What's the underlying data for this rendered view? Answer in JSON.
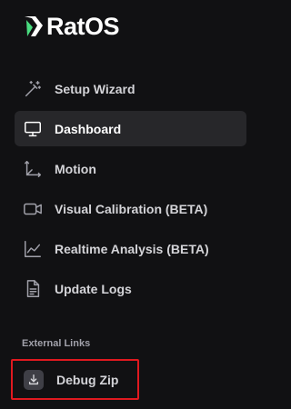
{
  "brand": {
    "name": "RatOS",
    "accent": "#4ade80"
  },
  "nav": {
    "items": [
      {
        "label": "Setup Wizard",
        "icon": "magic-wand-icon",
        "active": false
      },
      {
        "label": "Dashboard",
        "icon": "monitor-icon",
        "active": true
      },
      {
        "label": "Motion",
        "icon": "axes-icon",
        "active": false
      },
      {
        "label": "Visual Calibration (BETA)",
        "icon": "video-camera-icon",
        "active": false
      },
      {
        "label": "Realtime Analysis (BETA)",
        "icon": "line-chart-icon",
        "active": false
      },
      {
        "label": "Update Logs",
        "icon": "document-icon",
        "active": false
      }
    ]
  },
  "external_links": {
    "heading": "External Links",
    "items": [
      {
        "label": "Debug Zip",
        "icon": "download-icon",
        "highlight_color": "#e0191f"
      }
    ]
  },
  "colors": {
    "background": "#111113",
    "active_background": "#27272a"
  }
}
